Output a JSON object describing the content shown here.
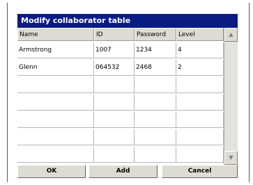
{
  "dialog": {
    "title": "Modify collaborator table"
  },
  "table": {
    "columns": [
      "Name",
      "ID",
      "Password",
      "Level"
    ],
    "rows": [
      [
        "Armstrong",
        "1007",
        "1234",
        "4"
      ],
      [
        "Glenn",
        "064532",
        "2468",
        "2"
      ],
      [
        "",
        "",
        "",
        ""
      ],
      [
        "",
        "",
        "",
        ""
      ],
      [
        "",
        "",
        "",
        ""
      ],
      [
        "",
        "",
        "",
        ""
      ],
      [
        "",
        "",
        "",
        ""
      ]
    ]
  },
  "scrollbar": {
    "up_icon": "scroll-up-arrow",
    "down_icon": "scroll-down-arrow"
  },
  "buttons": {
    "ok": "OK",
    "add": "Add",
    "cancel": "Cancel"
  }
}
